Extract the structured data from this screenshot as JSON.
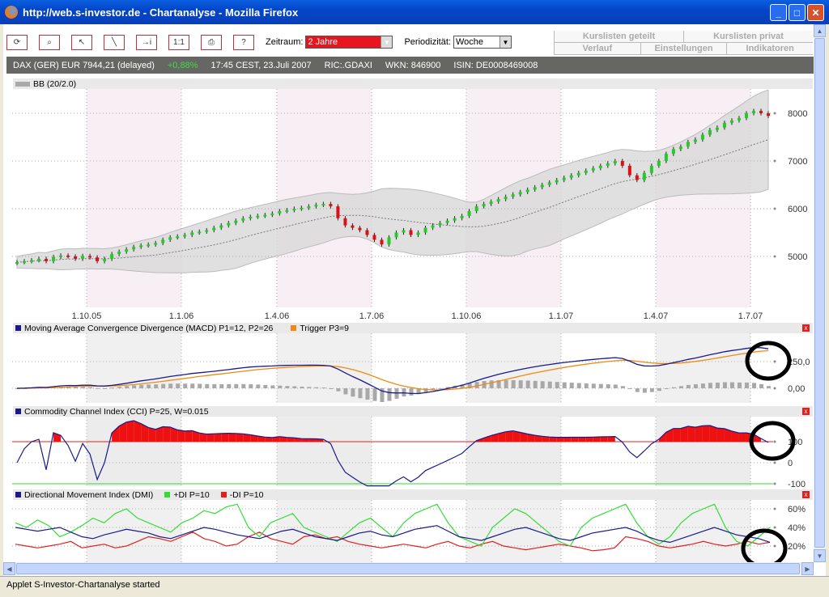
{
  "window": {
    "title": "http://web.s-investor.de - Chartanalyse - Mozilla Firefox",
    "minimize": "_",
    "maximize": "□",
    "close": "✕"
  },
  "toolbar": {
    "buttons": [
      {
        "name": "refresh-button",
        "glyph": "⟳"
      },
      {
        "name": "zoom-button",
        "glyph": "⌕"
      },
      {
        "name": "cursor-button",
        "glyph": "↖"
      },
      {
        "name": "trendline-button",
        "glyph": "╲"
      },
      {
        "name": "info-button",
        "glyph": "→i"
      },
      {
        "name": "reset-zoom-button",
        "glyph": "1:1"
      },
      {
        "name": "print-button",
        "glyph": "⎙"
      },
      {
        "name": "help-button",
        "glyph": "?"
      }
    ],
    "zeitraum_label": "Zeitraum:",
    "zeitraum_value": "2 Jahre",
    "periodizitaet_label": "Periodizität:",
    "periodizitaet_value": "Woche"
  },
  "tabs": {
    "row1": [
      "Kurslisten geteilt",
      "Kurslisten privat"
    ],
    "row2": [
      "Verlauf",
      "Einstellungen",
      "Indikatoren"
    ]
  },
  "info": {
    "name": "DAX (GER) EUR 7944,21 (delayed)",
    "change": "+0,88%",
    "time": "17:45 CEST, 23.Juli 2007",
    "ric": "RIC:.GDAXI",
    "wkn": "WKN: 846900",
    "isin": "ISIN: DE0008469008"
  },
  "colors": {
    "up": "#22cc22",
    "down": "#dd1111",
    "macd": "#1a1a8a",
    "trigger": "#f08a10",
    "plus_di": "#33dd33",
    "minus_di": "#e02020",
    "accent": "#c0303a"
  },
  "chart_data": [
    {
      "type": "candlestick",
      "title": "BB (20/2.0)",
      "ylim": [
        4400,
        8400
      ],
      "yticks": [
        "5000",
        "6000",
        "7000",
        "8000"
      ],
      "ytick_values": [
        5000,
        6000,
        7000,
        8000
      ],
      "xticks": [
        "1.10.05",
        "1.1.06",
        "1.4.06",
        "1.7.06",
        "1.10.06",
        "1.1.07",
        "1.4.07",
        "1.7.07"
      ],
      "closes": [
        4880,
        4900,
        4920,
        4950,
        4900,
        4990,
        5020,
        5000,
        4950,
        5010,
        4980,
        4900,
        4950,
        5050,
        5100,
        5150,
        5200,
        5230,
        5250,
        5280,
        5350,
        5400,
        5420,
        5450,
        5500,
        5520,
        5550,
        5600,
        5650,
        5700,
        5750,
        5800,
        5830,
        5850,
        5870,
        5900,
        5950,
        5970,
        6000,
        6020,
        6050,
        6080,
        6100,
        6050,
        5800,
        5650,
        5600,
        5550,
        5450,
        5350,
        5250,
        5400,
        5500,
        5550,
        5450,
        5500,
        5600,
        5650,
        5700,
        5750,
        5800,
        5850,
        5950,
        6050,
        6100,
        6150,
        6200,
        6250,
        6300,
        6350,
        6400,
        6450,
        6500,
        6550,
        6600,
        6650,
        6700,
        6750,
        6800,
        6850,
        6900,
        6950,
        7000,
        6900,
        6700,
        6600,
        6750,
        6900,
        7000,
        7150,
        7250,
        7300,
        7400,
        7450,
        7550,
        7650,
        7700,
        7800,
        7850,
        7900,
        8000,
        8050,
        8000,
        7944
      ]
    },
    {
      "type": "line",
      "title": "Moving Average Convergence Divergence (MACD) P1=12, P2=26",
      "legend2": "Trigger P3=9",
      "yticks": [
        "0,00",
        "250,0"
      ],
      "ylim": [
        -100,
        400
      ]
    },
    {
      "type": "area",
      "title": "Commodity Channel Index (CCI) P=25, W=0.015",
      "yticks": [
        "-100",
        "0",
        "100"
      ],
      "ylim": [
        -110,
        200
      ]
    },
    {
      "type": "line",
      "title": "Directional Movement Index (DMI)",
      "legend_plus": "+DI P=10",
      "legend_minus": "-DI P=10",
      "yticks": [
        "20%",
        "40%",
        "60%"
      ],
      "ylim": [
        10,
        68
      ],
      "plus_di": [
        45,
        40,
        48,
        42,
        30,
        35,
        42,
        50,
        45,
        55,
        60,
        50,
        45,
        40,
        35,
        45,
        50,
        58,
        55,
        62,
        65,
        40,
        30,
        45,
        50,
        55,
        40,
        35,
        30,
        25,
        35,
        45,
        50,
        40,
        30,
        45,
        55,
        60,
        65,
        45,
        30,
        25,
        20,
        40,
        50,
        60,
        55,
        45,
        35,
        25,
        20,
        40,
        50,
        55,
        60,
        65,
        45,
        30,
        22,
        30,
        45,
        55,
        60,
        65,
        40,
        25,
        20,
        30,
        40
      ],
      "minus_di": [
        22,
        20,
        18,
        20,
        22,
        25,
        18,
        20,
        22,
        18,
        20,
        25,
        30,
        28,
        25,
        30,
        35,
        28,
        25,
        20,
        22,
        30,
        35,
        28,
        25,
        22,
        30,
        32,
        28,
        30,
        25,
        22,
        20,
        18,
        20,
        22,
        20,
        18,
        22,
        25,
        20,
        18,
        22,
        25,
        20,
        18,
        16,
        18,
        20,
        22,
        20,
        18,
        15,
        16,
        18,
        30,
        28,
        25,
        20,
        18,
        20,
        22,
        25,
        22,
        20,
        22,
        25,
        22,
        24
      ],
      "adx": [
        40,
        38,
        36,
        38,
        40,
        35,
        30,
        28,
        32,
        35,
        38,
        36,
        34,
        30,
        28,
        32,
        36,
        40,
        38,
        35,
        32,
        30,
        28,
        32,
        36,
        38,
        34,
        30,
        28,
        26,
        30,
        34,
        36,
        32,
        30,
        34,
        38,
        40,
        42,
        36,
        30,
        28,
        26,
        30,
        34,
        38,
        40,
        36,
        32,
        28,
        26,
        30,
        34,
        36,
        38,
        40,
        36,
        30,
        26,
        24,
        28,
        32,
        36,
        40,
        36,
        32,
        30,
        28,
        24
      ]
    }
  ],
  "status": "Applet S-Investor-Chartanalyse started"
}
